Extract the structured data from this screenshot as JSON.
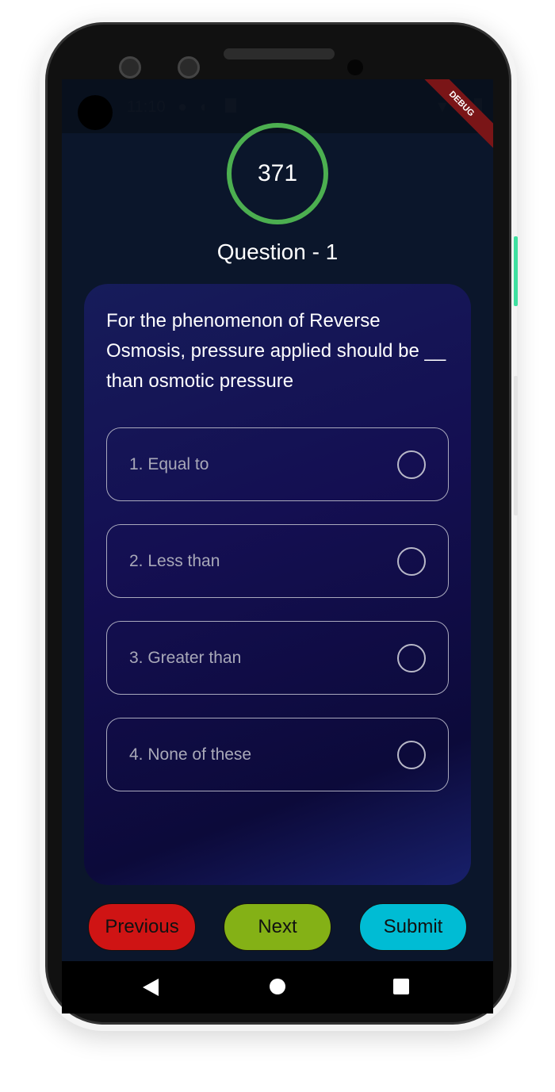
{
  "status_bar": {
    "time": "11:10",
    "debug_banner": "DEBUG"
  },
  "timer": {
    "value": "371"
  },
  "question": {
    "title": "Question - 1",
    "text": "For the phenomenon of Reverse Osmosis, pressure applied should be __ than osmotic pressure",
    "options": [
      {
        "label": "1. Equal to"
      },
      {
        "label": "2. Less than"
      },
      {
        "label": "3. Greater than"
      },
      {
        "label": "4. None of these"
      }
    ]
  },
  "buttons": {
    "previous": "Previous",
    "next": "Next",
    "submit": "Submit"
  },
  "colors": {
    "previous": "#cf1414",
    "next": "#84b116",
    "submit": "#00bcd4",
    "timer_ring": "#4caf50"
  }
}
